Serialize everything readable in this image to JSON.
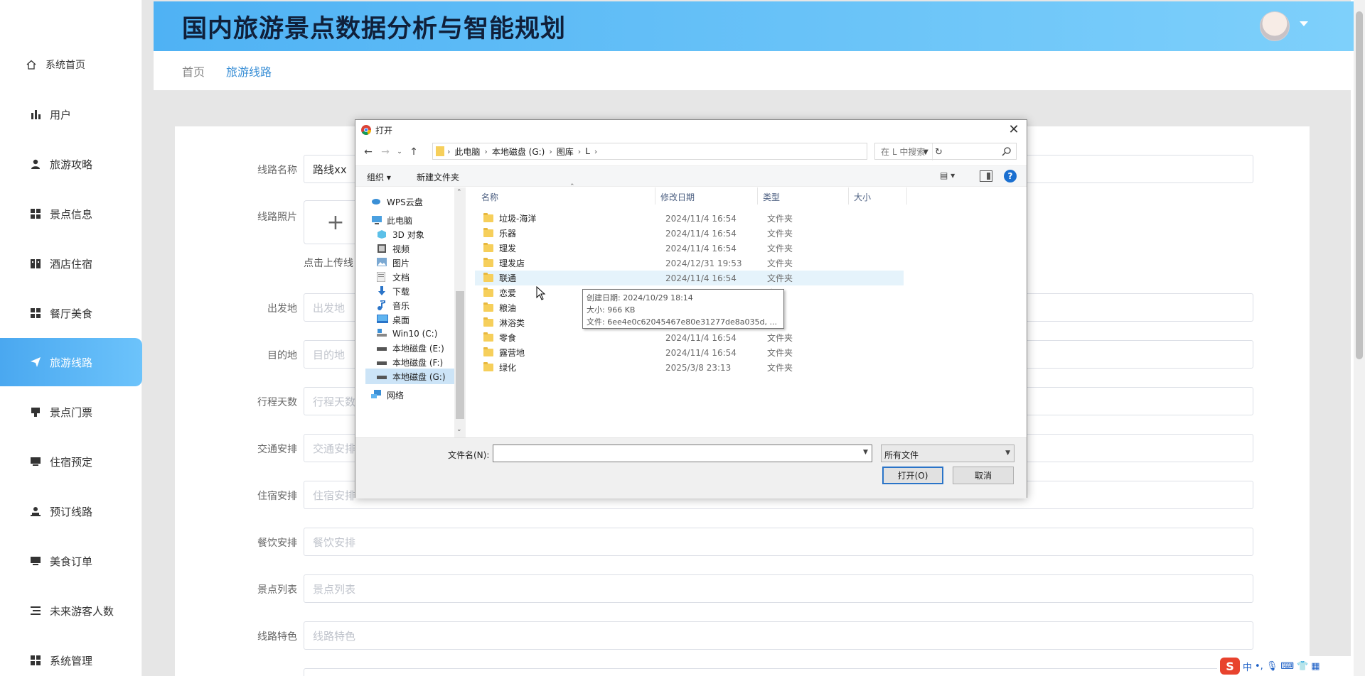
{
  "sidebar": {
    "items": [
      {
        "label": "系统首页",
        "icon": "home-icon"
      },
      {
        "label": "用户",
        "icon": "bar-chart-icon"
      },
      {
        "label": "旅游攻略",
        "icon": "user-icon"
      },
      {
        "label": "景点信息",
        "icon": "grid-icon"
      },
      {
        "label": "酒店住宿",
        "icon": "building-icon"
      },
      {
        "label": "餐厅美食",
        "icon": "grid-icon"
      },
      {
        "label": "旅游线路",
        "icon": "send-icon"
      },
      {
        "label": "景点门票",
        "icon": "ticket-icon"
      },
      {
        "label": "住宿预定",
        "icon": "monitor-icon"
      },
      {
        "label": "预订线路",
        "icon": "person-icon"
      },
      {
        "label": "美食订单",
        "icon": "monitor-icon"
      },
      {
        "label": "未来游客人数",
        "icon": "list-icon"
      },
      {
        "label": "系统管理",
        "icon": "grid-icon"
      }
    ]
  },
  "header": {
    "title": "国内旅游景点数据分析与智能规划"
  },
  "breadcrumb": {
    "home": "首页",
    "current": "旅游线路"
  },
  "form": {
    "route_name_label": "线路名称",
    "route_name_value": "路线xx",
    "route_photo_label": "线路照片",
    "upload_plus": "+",
    "upload_tip": "点击上传线",
    "fields": [
      {
        "label": "出发地",
        "placeholder": "出发地"
      },
      {
        "label": "目的地",
        "placeholder": "目的地"
      },
      {
        "label": "行程天数",
        "placeholder": "行程天数"
      },
      {
        "label": "交通安排",
        "placeholder": "交通安排"
      },
      {
        "label": "住宿安排",
        "placeholder": "住宿安排"
      },
      {
        "label": "餐饮安排",
        "placeholder": "餐饮安排"
      },
      {
        "label": "景点列表",
        "placeholder": "景点列表"
      },
      {
        "label": "线路特色",
        "placeholder": "线路特色"
      }
    ]
  },
  "dialog": {
    "title": "打开",
    "address": [
      "此电脑",
      "本地磁盘 (G:)",
      "图库",
      "L"
    ],
    "search_placeholder": "在 L 中搜索",
    "organize": "组织 ▾",
    "new_folder": "新建文件夹",
    "help": "?",
    "nav_items": [
      {
        "label": "WPS云盘",
        "icon": "cloud-icon"
      },
      {
        "label": "此电脑",
        "icon": "computer-icon"
      },
      {
        "label": "3D 对象",
        "icon": "cube-icon"
      },
      {
        "label": "视频",
        "icon": "video-icon"
      },
      {
        "label": "图片",
        "icon": "picture-icon"
      },
      {
        "label": "文档",
        "icon": "document-icon"
      },
      {
        "label": "下载",
        "icon": "download-icon"
      },
      {
        "label": "音乐",
        "icon": "music-icon"
      },
      {
        "label": "桌面",
        "icon": "desktop-icon"
      },
      {
        "label": "Win10 (C:)",
        "icon": "drive-icon"
      },
      {
        "label": "本地磁盘 (E:)",
        "icon": "drive-icon"
      },
      {
        "label": "本地磁盘 (F:)",
        "icon": "drive-icon"
      },
      {
        "label": "本地磁盘 (G:)",
        "icon": "drive-icon"
      },
      {
        "label": "网络",
        "icon": "network-icon"
      }
    ],
    "columns": {
      "name": "名称",
      "date": "修改日期",
      "type": "类型",
      "size": "大小"
    },
    "files": [
      {
        "name": "垃圾-海洋",
        "date": "2024/11/4 16:54",
        "type": "文件夹"
      },
      {
        "name": "乐器",
        "date": "2024/11/4 16:54",
        "type": "文件夹"
      },
      {
        "name": "理发",
        "date": "2024/11/4 16:54",
        "type": "文件夹"
      },
      {
        "name": "理发店",
        "date": "2024/12/31 19:53",
        "type": "文件夹"
      },
      {
        "name": "联通",
        "date": "2024/11/4 16:54",
        "type": "文件夹"
      },
      {
        "name": "恋爱",
        "date": "",
        "type": "夹"
      },
      {
        "name": "粮油",
        "date": "",
        "type": "夹"
      },
      {
        "name": "淋浴类",
        "date": "",
        "type": "夹"
      },
      {
        "name": "零食",
        "date": "2024/11/4 16:54",
        "type": "文件夹"
      },
      {
        "name": "露营地",
        "date": "2024/11/4 16:54",
        "type": "文件夹"
      },
      {
        "name": "绿化",
        "date": "2025/3/8 23:13",
        "type": "文件夹"
      }
    ],
    "tooltip": {
      "created": "创建日期: 2024/10/29 18:14",
      "size": "大小: 966 KB",
      "files": "文件: 6ee4e0c62045467e80e31277de8a035d, ..."
    },
    "filename_label": "文件名(N):",
    "filename_value": "",
    "filter": "所有文件",
    "open_button": "打开(O)",
    "cancel_button": "取消"
  },
  "ime": {
    "logo": "S",
    "mode": "中"
  },
  "colors": {
    "accent": "#4aa8f0",
    "header_start": "#4fb2f4",
    "header_end": "#7ed0fb"
  }
}
